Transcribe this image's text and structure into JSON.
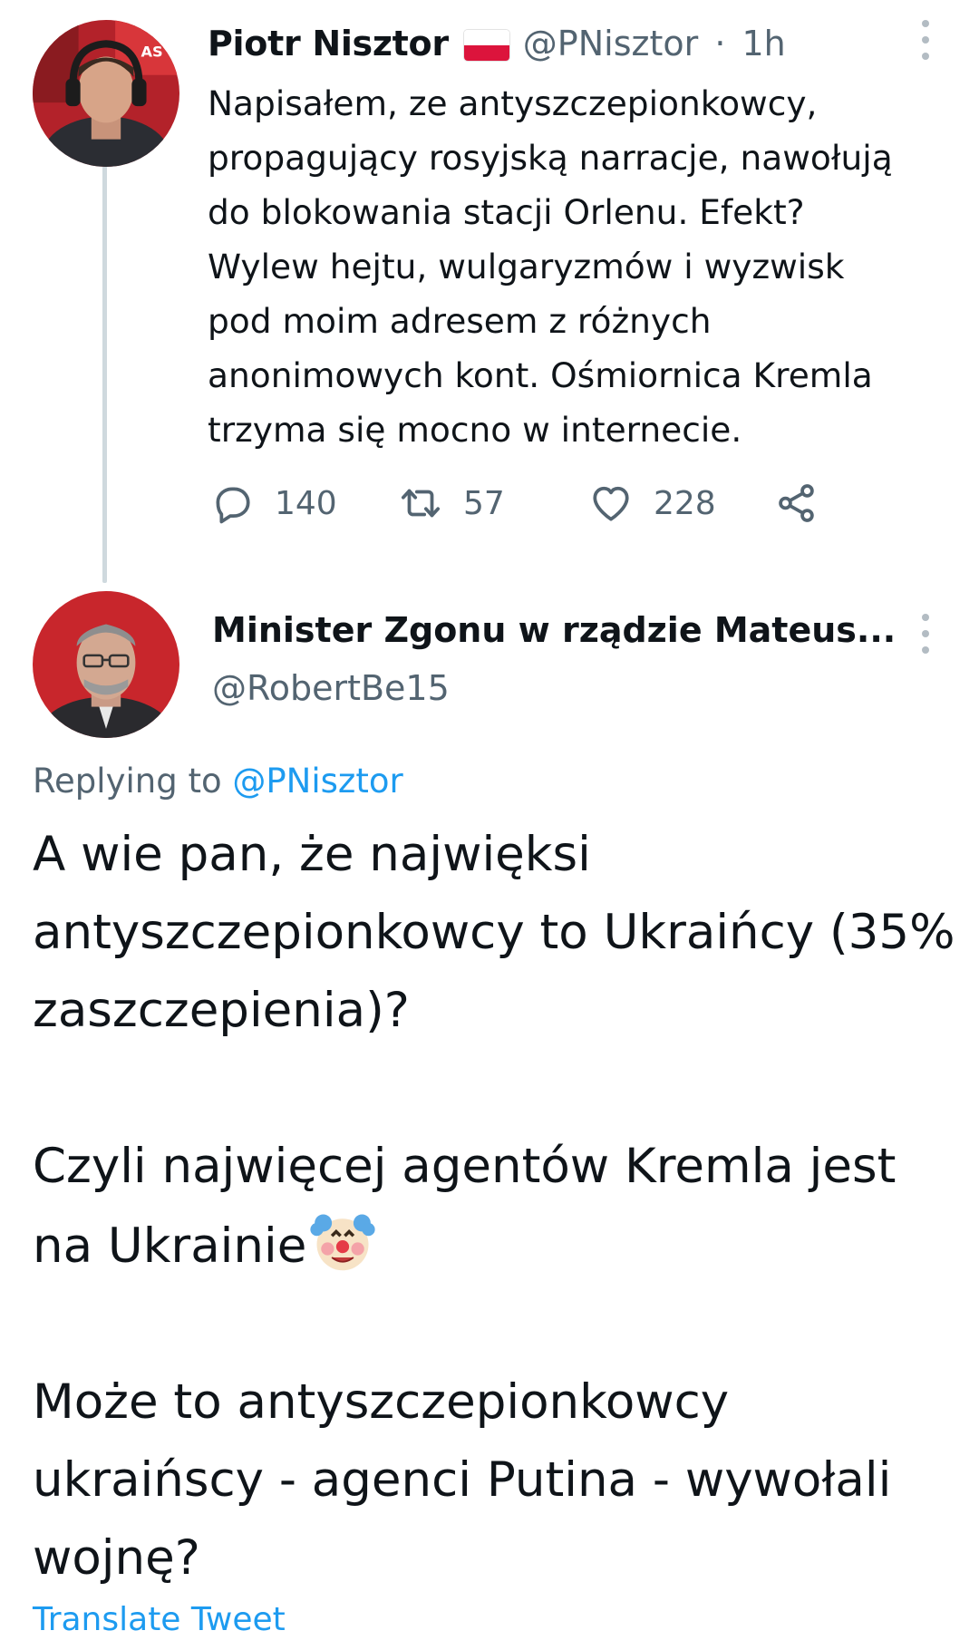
{
  "tweet1": {
    "display_name": "Piotr Nisztor",
    "handle": "@PNisztor",
    "separator": "·",
    "time": "1h",
    "text": "Napisałem, ze antyszczepionkowcy,\npropagujący rosyjską narracje, nawołują\ndo blokowania stacji Orlenu. Efekt?\nWylew hejtu, wulgaryzmów i wyzwisk\npod moim adresem z różnych\nanonimowych kont. Ośmiornica Kremla\ntrzyma się mocno w internecie.",
    "reply_count": "140",
    "retweet_count": "57",
    "like_count": "228"
  },
  "tweet2": {
    "display_name": "Minister Zgonu w rządzie Mateus...",
    "handle": "@RobertBe15",
    "replying_prefix": "Replying to",
    "replying_mention": "@PNisztor",
    "paragraphs": [
      "A wie pan, że najwięksi antyszczepionkowcy to Ukraińcy (35% zaszczepienia)?",
      "Czyli najwięcej agentów Kremla jest na Ukrainie",
      "Może to antyszczepionkowcy ukraińscy - agenci Putina - wywołali wojnę?"
    ],
    "translate_label": "Translate Tweet"
  },
  "icons": {
    "flag": "poland-flag-icon",
    "emoji": "clown-face-icon",
    "reply": "reply-icon",
    "retweet": "retweet-icon",
    "like": "heart-icon",
    "share": "share-icon",
    "more": "more-vertical-icon"
  },
  "colors": {
    "text": "#0f1419",
    "secondary": "#536471",
    "link": "#1d9bf0",
    "thread_line": "#cfd9de"
  }
}
